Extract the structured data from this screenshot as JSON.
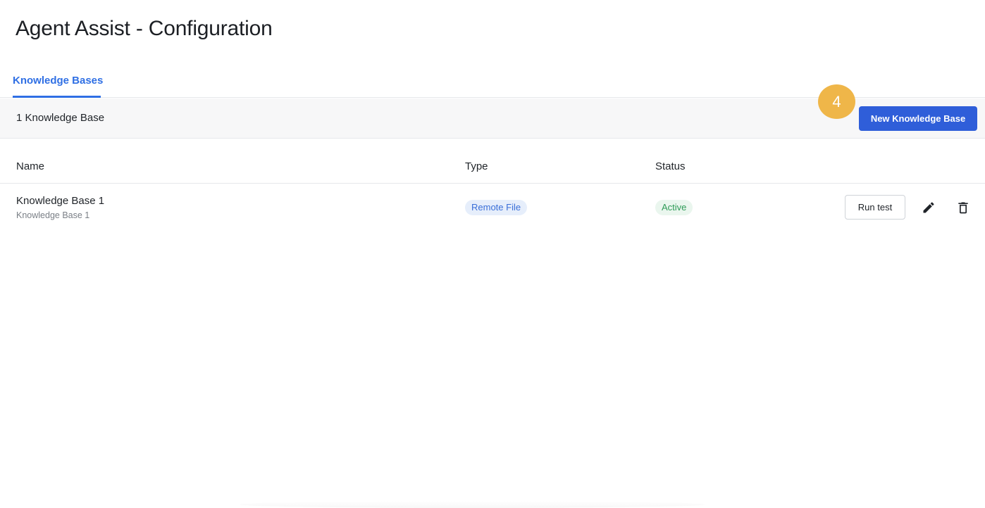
{
  "page": {
    "title": "Agent Assist - Configuration"
  },
  "tabs": {
    "active_label": "Knowledge Bases"
  },
  "toolbar": {
    "count_label": "1 Knowledge Base",
    "new_button_label": "New Knowledge Base",
    "step_badge": "4"
  },
  "table": {
    "columns": [
      "Name",
      "Type",
      "Status"
    ],
    "rows": [
      {
        "name": "Knowledge Base 1",
        "description": "Knowledge Base 1",
        "type": "Remote File",
        "status": "Active",
        "run_test_label": "Run test",
        "edit_icon": "pencil-icon",
        "delete_icon": "trash-icon"
      }
    ]
  },
  "colors": {
    "accent": "#2f5ed9",
    "tab_accent": "#2f6fe4",
    "badge": "#efb649",
    "type_pill_bg": "#e6eefb",
    "type_pill_text": "#3a6fd8",
    "status_pill_bg": "#eaf6ee",
    "status_pill_text": "#2e9b57"
  }
}
